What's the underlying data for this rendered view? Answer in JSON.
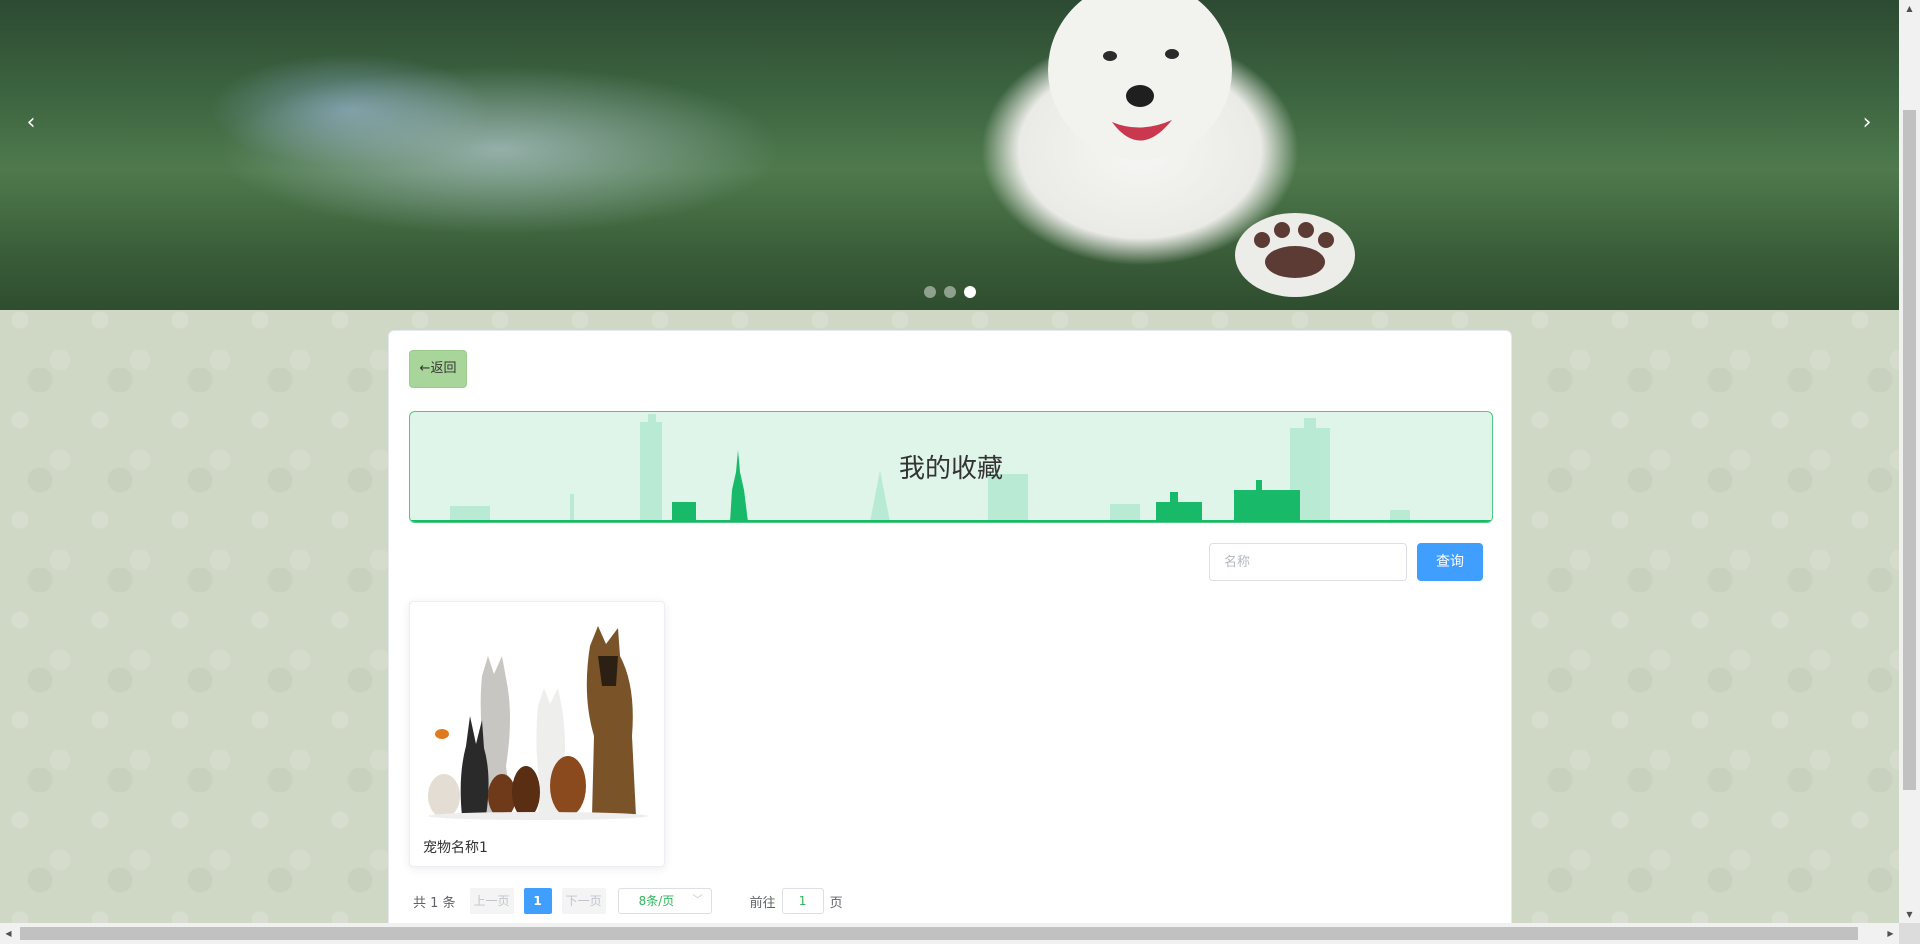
{
  "banner": {
    "prev_arrow": "‹",
    "next_arrow": "›",
    "slide_count": 3,
    "active_slide": 3
  },
  "page": {
    "back_label": "←返回",
    "title": "我的收藏"
  },
  "search": {
    "placeholder": "名称",
    "button_label": "查询"
  },
  "items": [
    {
      "name": "宠物名称1"
    }
  ],
  "pagination": {
    "total": "共 1 条",
    "prev": "上一页",
    "current_page": "1",
    "next": "下一页",
    "page_size": "8条/页",
    "goto_label": "前往",
    "goto_value": "1",
    "page_suffix": "页"
  },
  "colors": {
    "accent": "#409eff",
    "back_button": "#a8d69a",
    "title_bg": "#e0f5ea",
    "title_border": "#4fc785",
    "skyline": "#19b96a"
  }
}
